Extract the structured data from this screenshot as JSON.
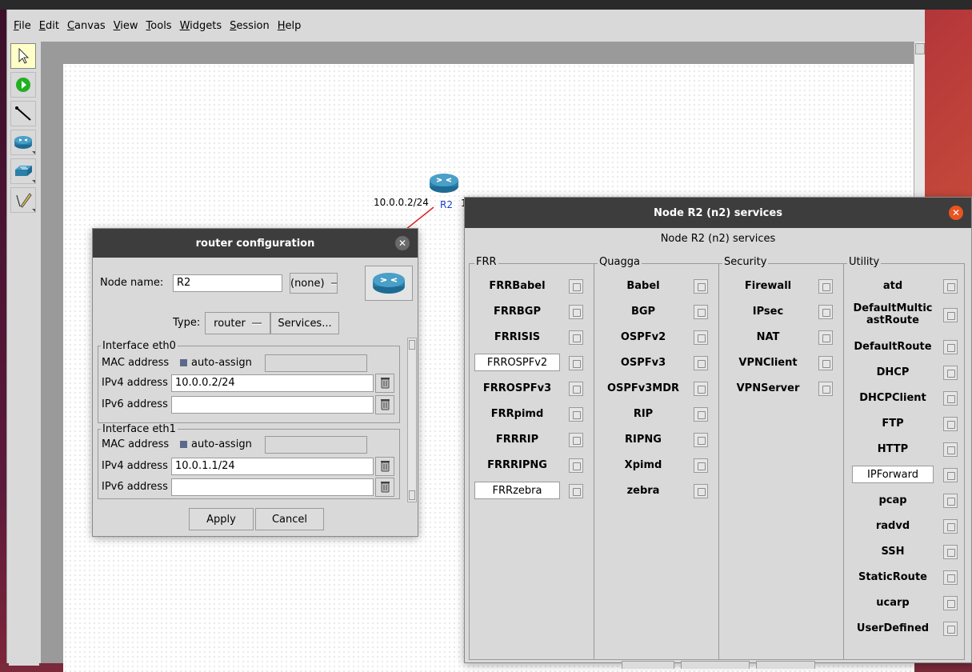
{
  "menubar": {
    "items": [
      {
        "label": "File",
        "u": "F",
        "rest": "ile"
      },
      {
        "label": "Edit",
        "u": "E",
        "rest": "dit"
      },
      {
        "label": "Canvas",
        "u": "C",
        "rest": "anvas"
      },
      {
        "label": "View",
        "u": "V",
        "rest": "iew"
      },
      {
        "label": "Tools",
        "u": "T",
        "rest": "ools"
      },
      {
        "label": "Widgets",
        "u": "W",
        "rest": "idgets"
      },
      {
        "label": "Session",
        "u": "S",
        "rest": "ession"
      },
      {
        "label": "Help",
        "u": "H",
        "rest": "elp"
      }
    ]
  },
  "toolbar": {
    "tools": [
      "select-tool",
      "start-session-tool",
      "link-tool",
      "network-layer-tool",
      "link-layer-tool",
      "annotation-tool"
    ]
  },
  "canvas": {
    "node_label": "R2",
    "link_label": "10.0.0.2/24",
    "link_label_partial": "1"
  },
  "router_config": {
    "title": "router configuration",
    "node_name_label": "Node name:",
    "node_name_value": "R2",
    "image_select": "(none)",
    "type_label": "Type:",
    "type_value": "router",
    "services_button": "Services...",
    "interfaces": [
      {
        "title": "Interface eth0",
        "mac_label": "MAC address",
        "auto_assign_label": "auto-assign",
        "mac_value": "",
        "ipv4_label": "IPv4 address",
        "ipv4_value": "10.0.0.2/24",
        "ipv6_label": "IPv6 address",
        "ipv6_value": ""
      },
      {
        "title": "Interface eth1",
        "mac_label": "MAC address",
        "auto_assign_label": "auto-assign",
        "mac_value": "",
        "ipv4_label": "IPv4 address",
        "ipv4_value": "10.0.1.1/24",
        "ipv6_label": "IPv6 address",
        "ipv6_value": ""
      }
    ],
    "apply_button": "Apply",
    "cancel_button": "Cancel"
  },
  "services_dialog": {
    "title": "Node R2 (n2) services",
    "subtitle": "Node R2 (n2) services",
    "columns": [
      {
        "heading": "FRR",
        "items": [
          {
            "label": "FRRBabel",
            "selected": false
          },
          {
            "label": "FRRBGP",
            "selected": false
          },
          {
            "label": "FRRISIS",
            "selected": false
          },
          {
            "label": "FRROSPFv2",
            "selected": true
          },
          {
            "label": "FRROSPFv3",
            "selected": false
          },
          {
            "label": "FRRpimd",
            "selected": false
          },
          {
            "label": "FRRRIP",
            "selected": false
          },
          {
            "label": "FRRRIPNG",
            "selected": false
          },
          {
            "label": "FRRzebra",
            "selected": true
          }
        ]
      },
      {
        "heading": "Quagga",
        "items": [
          {
            "label": "Babel",
            "selected": false
          },
          {
            "label": "BGP",
            "selected": false
          },
          {
            "label": "OSPFv2",
            "selected": false
          },
          {
            "label": "OSPFv3",
            "selected": false
          },
          {
            "label": "OSPFv3MDR",
            "selected": false
          },
          {
            "label": "RIP",
            "selected": false
          },
          {
            "label": "RIPNG",
            "selected": false
          },
          {
            "label": "Xpimd",
            "selected": false
          },
          {
            "label": "zebra",
            "selected": false
          }
        ]
      },
      {
        "heading": "Security",
        "items": [
          {
            "label": "Firewall",
            "selected": false
          },
          {
            "label": "IPsec",
            "selected": false
          },
          {
            "label": "NAT",
            "selected": false
          },
          {
            "label": "VPNClient",
            "selected": false
          },
          {
            "label": "VPNServer",
            "selected": false
          }
        ]
      },
      {
        "heading": "Utility",
        "items": [
          {
            "label": "atd",
            "selected": false
          },
          {
            "label": "DefaultMulticastRoute",
            "line1": "DefaultMultic",
            "line2": "astRoute",
            "selected": false
          },
          {
            "label": "DefaultRoute",
            "selected": false
          },
          {
            "label": "DHCP",
            "selected": false
          },
          {
            "label": "DHCPClient",
            "selected": false
          },
          {
            "label": "FTP",
            "selected": false
          },
          {
            "label": "HTTP",
            "selected": false
          },
          {
            "label": "IPForward",
            "selected": true
          },
          {
            "label": "pcap",
            "selected": false
          },
          {
            "label": "radvd",
            "selected": false
          },
          {
            "label": "SSH",
            "selected": false
          },
          {
            "label": "StaticRoute",
            "selected": false
          },
          {
            "label": "ucarp",
            "selected": false
          },
          {
            "label": "UserDefined",
            "selected": false
          }
        ]
      }
    ]
  },
  "colors": {
    "titlebar": "#3d3d3d",
    "close_orange": "#e95420",
    "router_blue": "#2b7fa8"
  }
}
